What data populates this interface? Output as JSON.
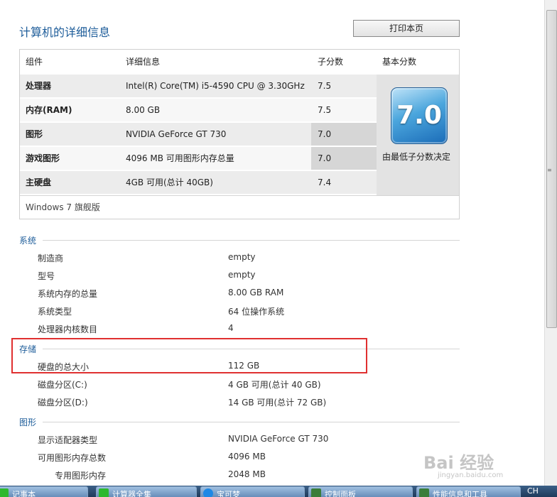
{
  "header": {
    "title": "计算机的详细信息",
    "print_label": "打印本页"
  },
  "score_table": {
    "headers": [
      "组件",
      "详细信息",
      "子分数",
      "基本分数"
    ],
    "rows": [
      {
        "component": "处理器",
        "detail": "Intel(R) Core(TM) i5-4590 CPU @ 3.30GHz",
        "score": "7.5"
      },
      {
        "component": "内存(RAM)",
        "detail": "8.00 GB",
        "score": "7.5"
      },
      {
        "component": "图形",
        "detail": "NVIDIA GeForce GT 730",
        "score": "7.0"
      },
      {
        "component": "游戏图形",
        "detail": "4096 MB 可用图形内存总量",
        "score": "7.0"
      },
      {
        "component": "主硬盘",
        "detail": "4GB 可用(总计 40GB)",
        "score": "7.4"
      }
    ],
    "base_score": "7.0",
    "base_note": "由最低子分数决定",
    "edition": "Windows 7 旗舰版"
  },
  "system": {
    "heading": "系统",
    "items": [
      {
        "label": "制造商",
        "value": "empty"
      },
      {
        "label": "型号",
        "value": "empty"
      },
      {
        "label": "系统内存的总量",
        "value": "8.00 GB RAM"
      },
      {
        "label": "系统类型",
        "value": "64 位操作系统"
      },
      {
        "label": "处理器内核数目",
        "value": "4"
      }
    ]
  },
  "storage": {
    "heading": "存储",
    "items": [
      {
        "label": "硬盘的总大小",
        "value": "112 GB"
      },
      {
        "label": "磁盘分区(C:)",
        "value": "4 GB 可用(总计 40 GB)"
      },
      {
        "label": "磁盘分区(D:)",
        "value": "14 GB 可用(总计 72 GB)"
      }
    ]
  },
  "graphics": {
    "heading": "图形",
    "items": [
      {
        "label": "显示适配器类型",
        "value": "NVIDIA GeForce GT 730"
      },
      {
        "label": "可用图形内存总数",
        "value": "4096 MB"
      },
      {
        "label": "专用图形内存",
        "value": "2048 MB"
      }
    ]
  },
  "colors": {
    "accent": "#1e5d9a",
    "highlight": "#e03030",
    "row_alt": "#e8e8e8",
    "row_score_dark": "#d8d8d8"
  },
  "taskbar": {
    "items": [
      {
        "label": "记事本",
        "icon": "notepad-icon",
        "color": "#2eb82e"
      },
      {
        "label": "计算器全集",
        "icon": "calculator-icon",
        "color": "#2eb82e"
      },
      {
        "label": "宝可梦",
        "icon": "browser-icon",
        "color": "#1e88e5"
      },
      {
        "label": "控制面板",
        "icon": "control-panel-icon",
        "color": "#3a7d3a"
      },
      {
        "label": "性能信息和工具",
        "icon": "performance-icon",
        "color": "#3a7d3a"
      },
      {
        "label": "CH",
        "icon": "language-icon",
        "color": "#1f3b5b"
      }
    ]
  },
  "watermark": {
    "text": "Bai 经验",
    "sub": "jingyan.baidu.com"
  }
}
